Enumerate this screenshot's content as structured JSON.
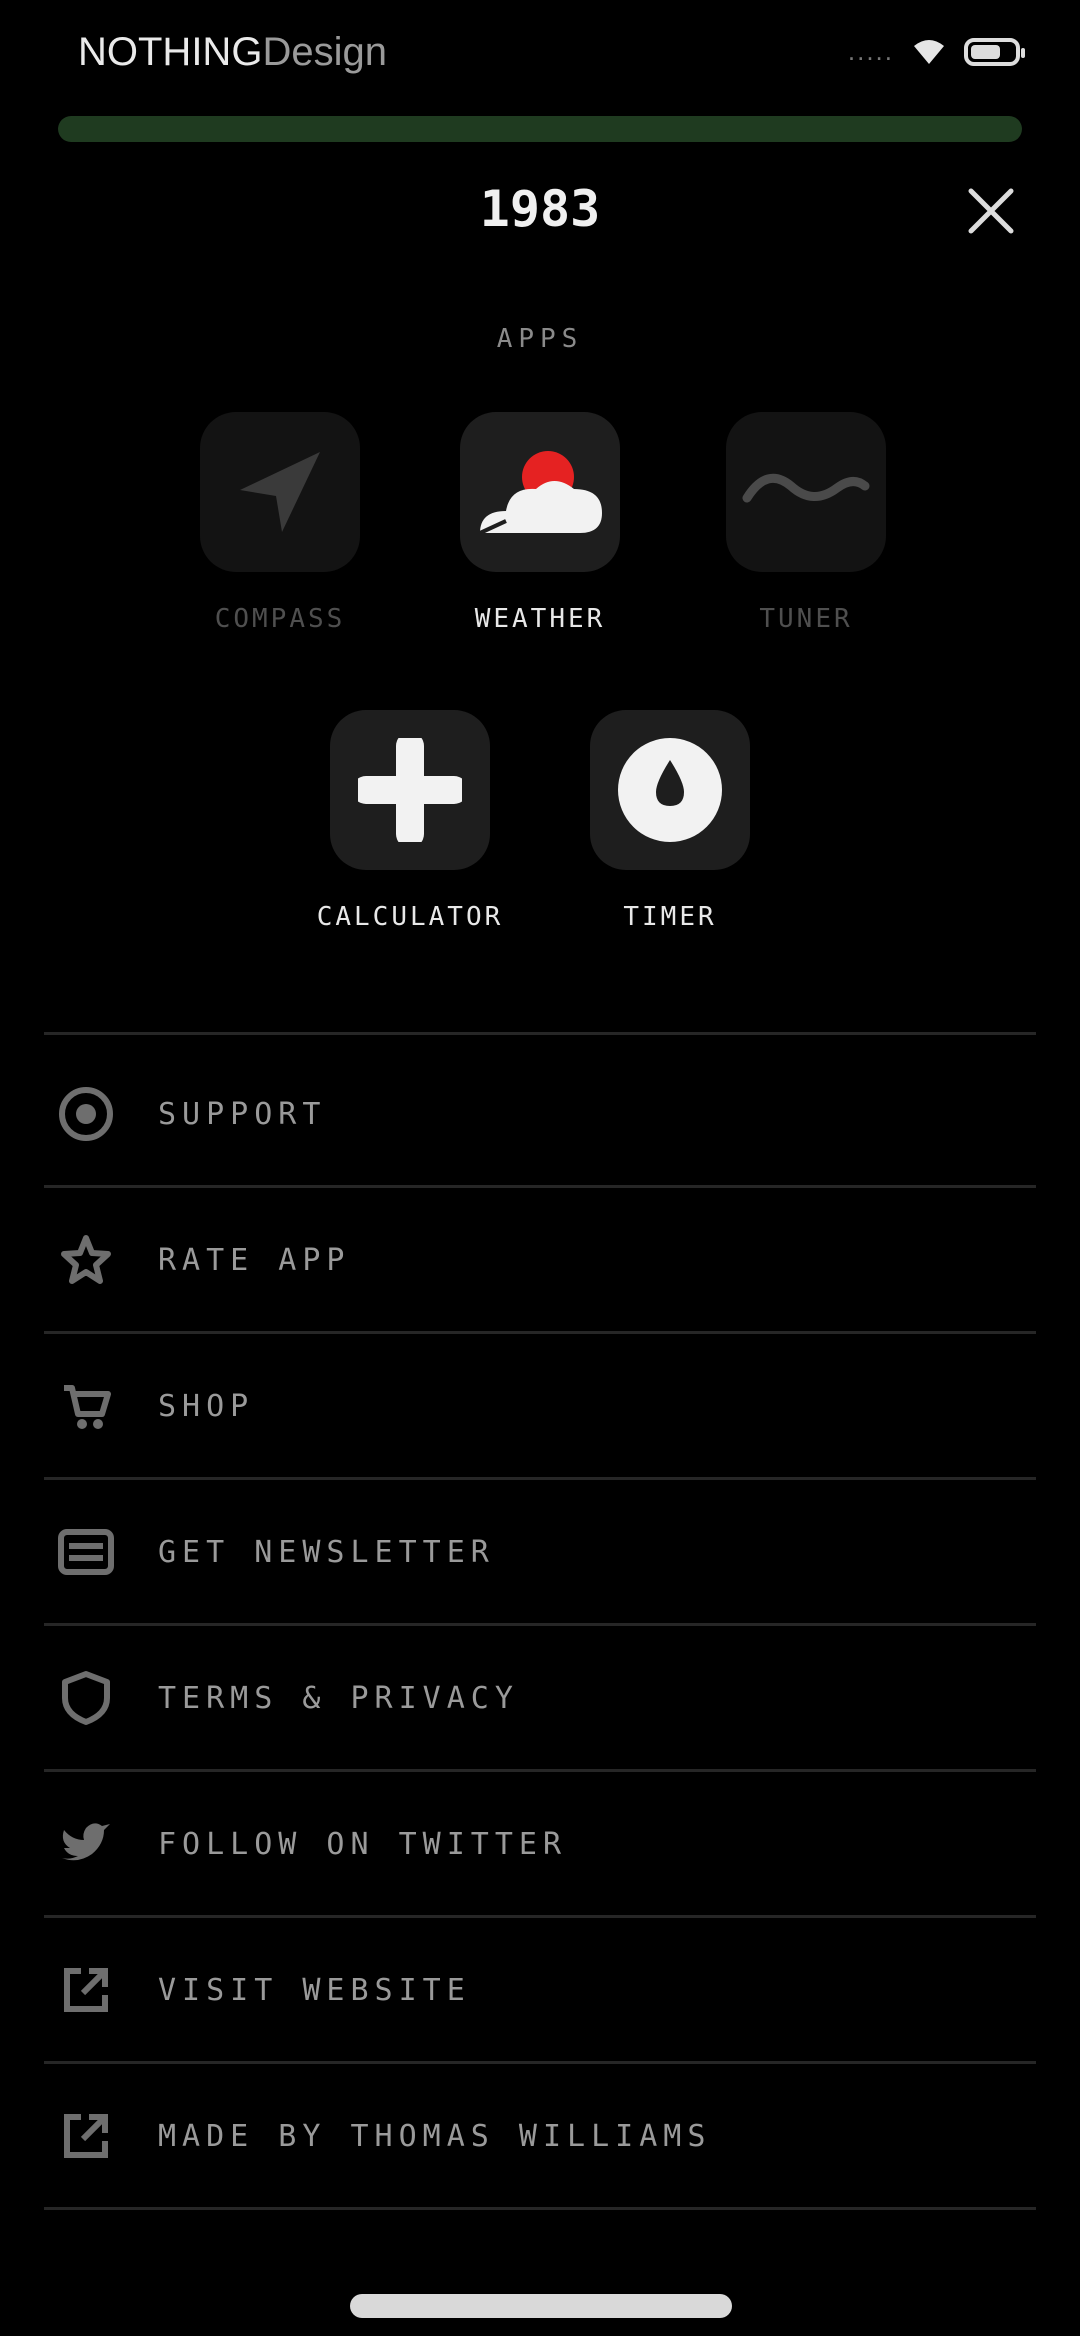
{
  "status_bar": {
    "carrier_bold": "NOTHING",
    "carrier_light": "Design",
    "signal": "....."
  },
  "progress": {
    "fraction": 1.0
  },
  "header": {
    "title": "1983",
    "close_label": "close"
  },
  "apps_section": {
    "label": "APPS",
    "apps": [
      {
        "label": "COMPASS",
        "icon": "navigation-arrow-icon",
        "state": "dim"
      },
      {
        "label": "WEATHER",
        "icon": "weather-cloud-sun-icon",
        "state": "active"
      },
      {
        "label": "TUNER",
        "icon": "wave-icon",
        "state": "dim"
      },
      {
        "label": "CALCULATOR",
        "icon": "calculator-plus-icon",
        "state": "active"
      },
      {
        "label": "TIMER",
        "icon": "timer-drop-icon",
        "state": "active"
      }
    ]
  },
  "menu": {
    "items": [
      {
        "label": "SUPPORT",
        "icon": "support-icon"
      },
      {
        "label": "RATE APP",
        "icon": "star-icon"
      },
      {
        "label": "SHOP",
        "icon": "shop-icon"
      },
      {
        "label": "GET NEWSLETTER",
        "icon": "newsletter-icon"
      },
      {
        "label": "TERMS & PRIVACY",
        "icon": "shield-icon"
      },
      {
        "label": "FOLLOW ON TWITTER",
        "icon": "twitter-icon"
      },
      {
        "label": "VISIT WEBSITE",
        "icon": "external-link-icon"
      },
      {
        "label": "MADE BY THOMAS WILLIAMS",
        "icon": "external-link-icon"
      }
    ]
  },
  "colors": {
    "background": "#000000",
    "weather_sun": "#e52222",
    "progress_fill": "#1f3b20"
  }
}
